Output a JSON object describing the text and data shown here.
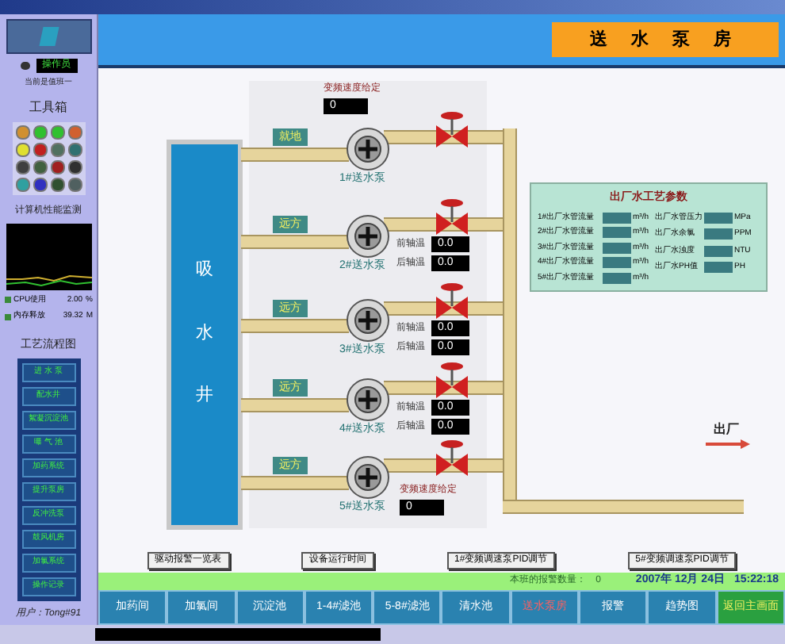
{
  "sidebar": {
    "operator": "操作员",
    "login": "当前是值班一",
    "toolbox": {
      "title": "工具箱"
    },
    "monitor": {
      "title": "计算机性能监测",
      "lines": [
        {
          "label": "CPU使用",
          "value": "2.00",
          "unit": "%"
        },
        {
          "label": "内存释放",
          "value": "39.32",
          "unit": "M"
        }
      ]
    },
    "process": {
      "title": "工艺流程图",
      "items": [
        "进 水 泵",
        "配水井",
        "絮凝沉淀池",
        "曝 气 池",
        "加药系统",
        "提升泵房",
        "反冲洗泵",
        "鼓风机房",
        "加氯系统",
        "操作记录"
      ]
    },
    "user": "用户：Tong#91"
  },
  "header": {
    "title": "送 水 泵 房"
  },
  "well": {
    "label": "吸水井"
  },
  "pumps": [
    {
      "name": "1#送水泵",
      "mode": "就地",
      "kind": "variable",
      "speed": {
        "label": "变频速度给定",
        "value": "0"
      }
    },
    {
      "name": "2#送水泵",
      "mode": "远方",
      "kind": "fixed",
      "readings": [
        {
          "label": "前轴温",
          "value": "0.0"
        },
        {
          "label": "后轴温",
          "value": "0.0"
        }
      ]
    },
    {
      "name": "3#送水泵",
      "mode": "远方",
      "kind": "fixed",
      "readings": [
        {
          "label": "前轴温",
          "value": "0.0"
        },
        {
          "label": "后轴温",
          "value": "0.0"
        }
      ]
    },
    {
      "name": "4#送水泵",
      "mode": "远方",
      "kind": "fixed",
      "readings": [
        {
          "label": "前轴温",
          "value": "0.0"
        },
        {
          "label": "后轴温",
          "value": "0.0"
        }
      ]
    },
    {
      "name": "5#送水泵",
      "mode": "远方",
      "kind": "variable",
      "speed": {
        "label": "变频速度给定",
        "value": "0"
      }
    }
  ],
  "outlet_panel": {
    "title": "出厂水工艺参数",
    "flows": [
      {
        "label": "1#出厂水管流量",
        "unit": "m³/h"
      },
      {
        "label": "2#出厂水管流量",
        "unit": "m³/h"
      },
      {
        "label": "3#出厂水管流量",
        "unit": "m³/h"
      },
      {
        "label": "4#出厂水管流量",
        "unit": "m³/h"
      },
      {
        "label": "5#出厂水管流量",
        "unit": "m³/h"
      }
    ],
    "quality": [
      {
        "label": "出厂水管压力",
        "unit": "MPa"
      },
      {
        "label": "出厂水余氯",
        "unit": "PPM"
      },
      {
        "label": "出厂水浊度",
        "unit": "NTU"
      },
      {
        "label": "出厂水PH值",
        "unit": "PH"
      }
    ]
  },
  "outlet_label": "出厂",
  "buttons": [
    "驱动报警一览表",
    "设备运行时间",
    "1#变频调速泵PID调节",
    "5#变频调速泵PID调节"
  ],
  "status": {
    "alarm_label": "本班的报警数量：",
    "alarm_count": "0",
    "date": "2007年 12月 24日",
    "time": "15:22:18"
  },
  "nav": [
    {
      "label": "加药间",
      "selected": false,
      "kind": "page"
    },
    {
      "label": "加氯间",
      "selected": false,
      "kind": "page"
    },
    {
      "label": "沉淀池",
      "selected": false,
      "kind": "page"
    },
    {
      "label": "1-4#滤池",
      "selected": false,
      "kind": "page"
    },
    {
      "label": "5-8#滤池",
      "selected": false,
      "kind": "page"
    },
    {
      "label": "清水池",
      "selected": false,
      "kind": "page"
    },
    {
      "label": "送水泵房",
      "selected": true,
      "kind": "page"
    },
    {
      "label": "报警",
      "selected": false,
      "kind": "page"
    },
    {
      "label": "趋势图",
      "selected": false,
      "kind": "page"
    },
    {
      "label": "返回主画面",
      "selected": false,
      "kind": "home"
    }
  ]
}
